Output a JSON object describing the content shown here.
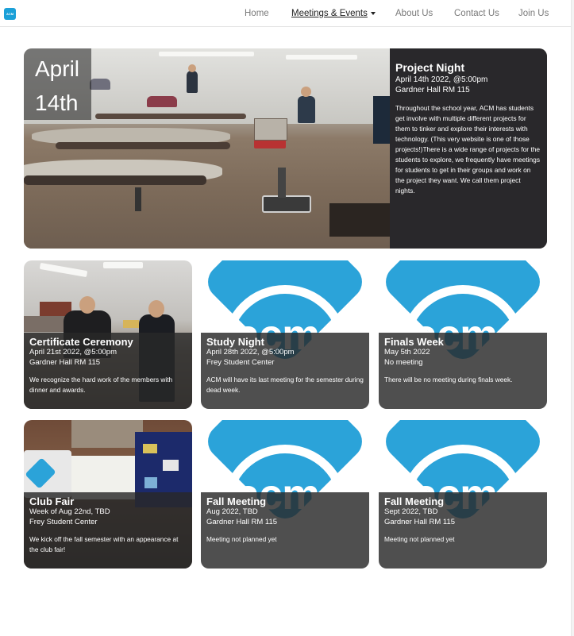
{
  "nav": {
    "logo_text": "ACM",
    "items": [
      {
        "label": "Home",
        "active": false
      },
      {
        "label": "Meetings & Events",
        "active": true,
        "dropdown": true
      },
      {
        "label": "About Us",
        "active": false
      },
      {
        "label": "Contact Us",
        "active": false
      },
      {
        "label": "Join Us",
        "active": false
      }
    ]
  },
  "feature": {
    "date_line1": "April",
    "date_line2": "14th",
    "title": "Project Night",
    "datetime": "April 14th 2022, @5:00pm",
    "location": "Gardner Hall RM 115",
    "description": "Throughout the school year, ACM has students get involve with multiple different projects for them to tinker and explore their interests with technology. (This very website is one of those projects!)There is a wide range of projects for the students to explore, we frequently have meetings for students to get in their groups and work on the project they want. We call them project nights."
  },
  "acm_logo_text": "acm",
  "cards": [
    {
      "title": "Certificate Ceremony",
      "datetime": "April 21st 2022, @5:00pm",
      "location": "Gardner Hall RM 115",
      "description": "We recognize the hard work of the members with dinner and awards."
    },
    {
      "title": "Study Night",
      "datetime": "April 28th 2022, @5:00pm",
      "location": "Frey Student Center",
      "description": "ACM will have its last meeting for the semester during dead week."
    },
    {
      "title": "Finals Week",
      "datetime": "May 5th 2022",
      "location": "No meeting",
      "description": "There will be no meeting during finals week."
    },
    {
      "title": "Club Fair",
      "datetime": "Week of Aug 22nd, TBD",
      "location": "Frey Student Center",
      "description": "We kick off the fall semester with an appearance at the club fair!"
    },
    {
      "title": "Fall Meeting",
      "datetime": "Aug 2022, TBD",
      "location": "Gardner Hall RM 115",
      "description": "Meeting not planned yet"
    },
    {
      "title": "Fall Meeting",
      "datetime": "Sept 2022, TBD",
      "location": "Gardner Hall RM 115",
      "description": "Meeting not planned yet"
    }
  ],
  "colors": {
    "acm_blue": "#2ba3d9",
    "overlay": "#282828"
  }
}
